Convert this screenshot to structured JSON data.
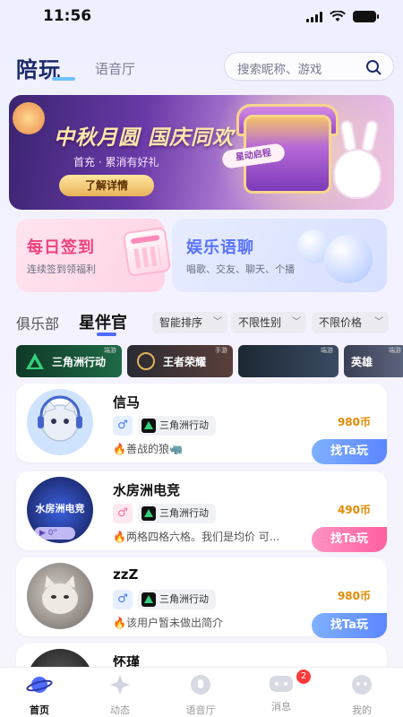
{
  "status_bar": {
    "time": "11:56"
  },
  "header": {
    "logo": "陪玩",
    "subtitle": "语音厅",
    "search": {
      "placeholder": "搜索昵称、游戏"
    }
  },
  "banner": {
    "title": "中秋月圆 国庆同欢",
    "subtitle": "首充 · 累消有好礼",
    "button_label": "了解详情",
    "tag": "星动启程"
  },
  "feature_cards": [
    {
      "title": "每日签到",
      "subtitle": "连续签到领福利",
      "accent": "#f0417e"
    },
    {
      "title": "娱乐语聊",
      "subtitle": "唱歌、交友、聊天、个播",
      "accent": "#5a73ff"
    }
  ],
  "tabs": [
    {
      "label": "俱乐部"
    },
    {
      "label": "星伴官",
      "active": true
    }
  ],
  "filters": [
    {
      "label": "智能排序"
    },
    {
      "label": "不限性别"
    },
    {
      "label": "不限价格"
    }
  ],
  "game_strip": [
    {
      "label": "三角洲行动",
      "tag": "端游"
    },
    {
      "label": "王者荣耀",
      "tag": "手游"
    },
    {
      "label": "",
      "tag": "端游"
    },
    {
      "label": "英雄",
      "tag": "端游"
    }
  ],
  "players": [
    {
      "name": "信马",
      "gender": "♂",
      "game": "三角洲行动",
      "price": "980币",
      "intro": "🔥善战的狼🦏",
      "button": "找Ta玩"
    },
    {
      "name": "水房洲电竞",
      "gender": "♂",
      "game": "三角洲行动",
      "price": "490币",
      "intro": "🔥两格四格六格。我们是均价 可...",
      "button": "找Ta玩",
      "avatar_text": "水房洲电竞",
      "audio": "0\""
    },
    {
      "name": "zzZ",
      "gender": "♂",
      "game": "三角洲行动",
      "price": "980币",
      "intro": "🔥该用户暂未做出简介",
      "button": "找Ta玩"
    },
    {
      "name": "怀瑾"
    }
  ],
  "bottom_nav": [
    {
      "label": "首页",
      "icon": "planet-icon",
      "active": true
    },
    {
      "label": "动态",
      "icon": "sparkle-icon"
    },
    {
      "label": "语音厅",
      "icon": "voice-icon"
    },
    {
      "label": "消息",
      "icon": "chat-icon",
      "badge": "2"
    },
    {
      "label": "我的",
      "icon": "profile-icon"
    }
  ],
  "colors": {
    "accent_blue": "#4f6cff",
    "price": "#e18b00",
    "badge_red": "#ff3b3b"
  }
}
